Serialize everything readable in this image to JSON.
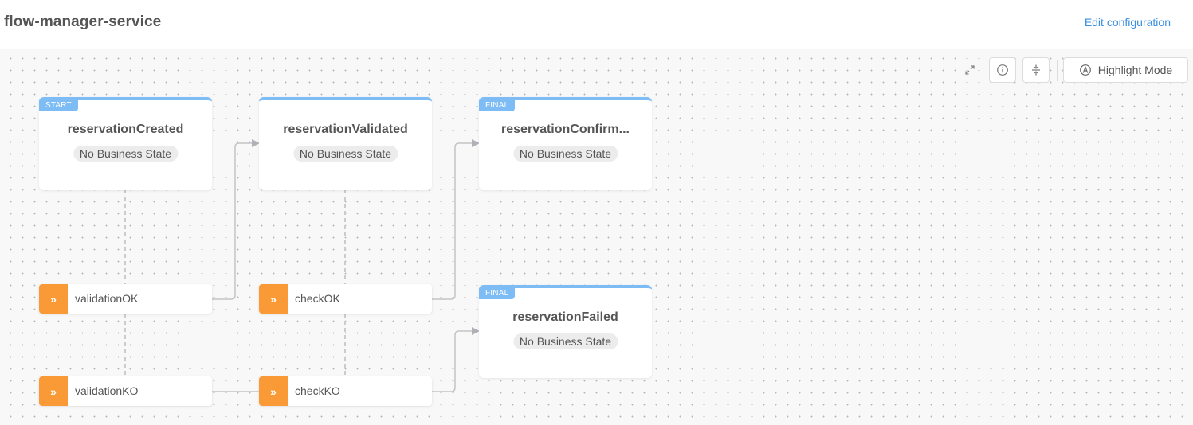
{
  "header": {
    "title": "flow-manager-service",
    "edit_link": "Edit configuration"
  },
  "toolbar": {
    "fit_icon": "expand-arrows-icon",
    "info_icon": "info-circle-icon",
    "compress_icon": "compress-vertical-icon",
    "highlight_label": "Highlight Mode",
    "highlight_icon": "circled-a-icon"
  },
  "states": [
    {
      "id": "reservationCreated",
      "tag": "START",
      "name": "reservationCreated",
      "business_state": "No Business State"
    },
    {
      "id": "reservationValidated",
      "tag": "",
      "name": "reservationValidated",
      "business_state": "No Business State"
    },
    {
      "id": "reservationConfirmed",
      "tag": "FINAL",
      "name": "reservationConfirm...",
      "business_state": "No Business State"
    },
    {
      "id": "reservationFailed",
      "tag": "FINAL",
      "name": "reservationFailed",
      "business_state": "No Business State"
    }
  ],
  "events": [
    {
      "name": "validationOK",
      "icon": "double-chevron-right-icon"
    },
    {
      "name": "validationKO",
      "icon": "double-chevron-right-icon"
    },
    {
      "name": "checkOK",
      "icon": "double-chevron-right-icon"
    },
    {
      "name": "checkKO",
      "icon": "double-chevron-right-icon"
    }
  ],
  "transitions": [
    {
      "from": "reservationCreated",
      "event": "validationOK",
      "to": "reservationValidated"
    },
    {
      "from": "reservationCreated",
      "event": "validationKO",
      "to": "checkKO"
    },
    {
      "from": "reservationValidated",
      "event": "checkOK",
      "to": "reservationConfirmed"
    },
    {
      "from": "reservationValidated",
      "event": "checkKO",
      "to": "reservationFailed"
    }
  ],
  "colors": {
    "state_accent": "#7dbcf5",
    "event_accent": "#fa9a36",
    "link": "#3b8fe0"
  }
}
